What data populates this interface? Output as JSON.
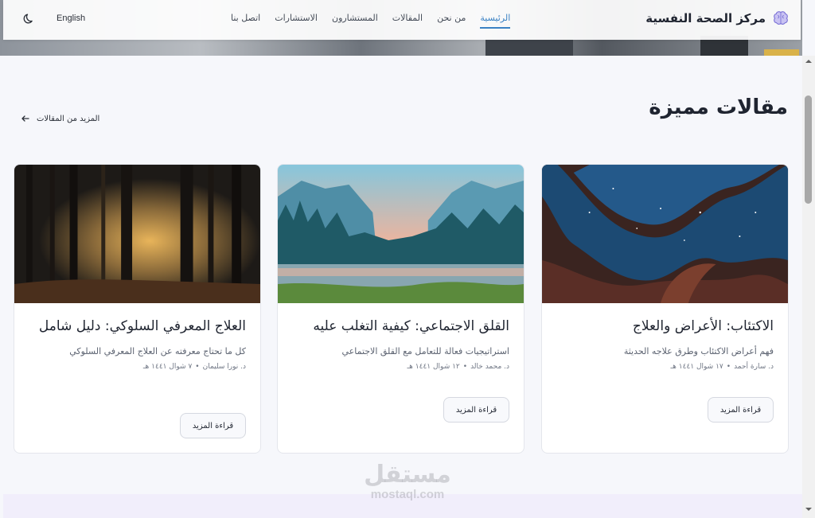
{
  "navbar": {
    "brand": "مركز الصحة النفسية",
    "links": [
      {
        "label": "الرئيسية",
        "active": true
      },
      {
        "label": "من نحن",
        "active": false
      },
      {
        "label": "المقالات",
        "active": false
      },
      {
        "label": "المستشارون",
        "active": false
      },
      {
        "label": "الاستشارات",
        "active": false
      },
      {
        "label": "اتصل بنا",
        "active": false
      }
    ],
    "language": "English",
    "theme_icon": "moon-icon"
  },
  "section": {
    "title": "مقالات مميزة",
    "more_link": "المزيد من المقالات"
  },
  "articles": [
    {
      "title": "الاكتئاب: الأعراض والعلاج",
      "description": "فهم أعراض الاكتئاب وطرق علاجه الحديثة",
      "author": "د. سارة أحمد",
      "date": "١٧ شوال ١٤٤١ هـ",
      "button": "قراءة المزيد",
      "image": "starry-cave-image"
    },
    {
      "title": "القلق الاجتماعي: كيفية التغلب عليه",
      "description": "استراتيجيات فعالة للتعامل مع القلق الاجتماعي",
      "author": "د. محمد خالد",
      "date": "١٢ شوال ١٤٤١ هـ",
      "button": "قراءة المزيد",
      "image": "mountain-lake-image"
    },
    {
      "title": "العلاج المعرفي السلوكي: دليل شامل",
      "description": "كل ما تحتاج معرفته عن العلاج المعرفي السلوكي",
      "author": "د. نورا سليمان",
      "date": "٧ شوال ١٤٤١ هـ",
      "button": "قراءة المزيد",
      "image": "misty-forest-image"
    }
  ],
  "watermark": {
    "arabic": "مستقل",
    "latin": "mostaql.com"
  },
  "colors": {
    "accent": "#3b82c4",
    "text": "#1f2430",
    "background": "#f6f7fb"
  }
}
